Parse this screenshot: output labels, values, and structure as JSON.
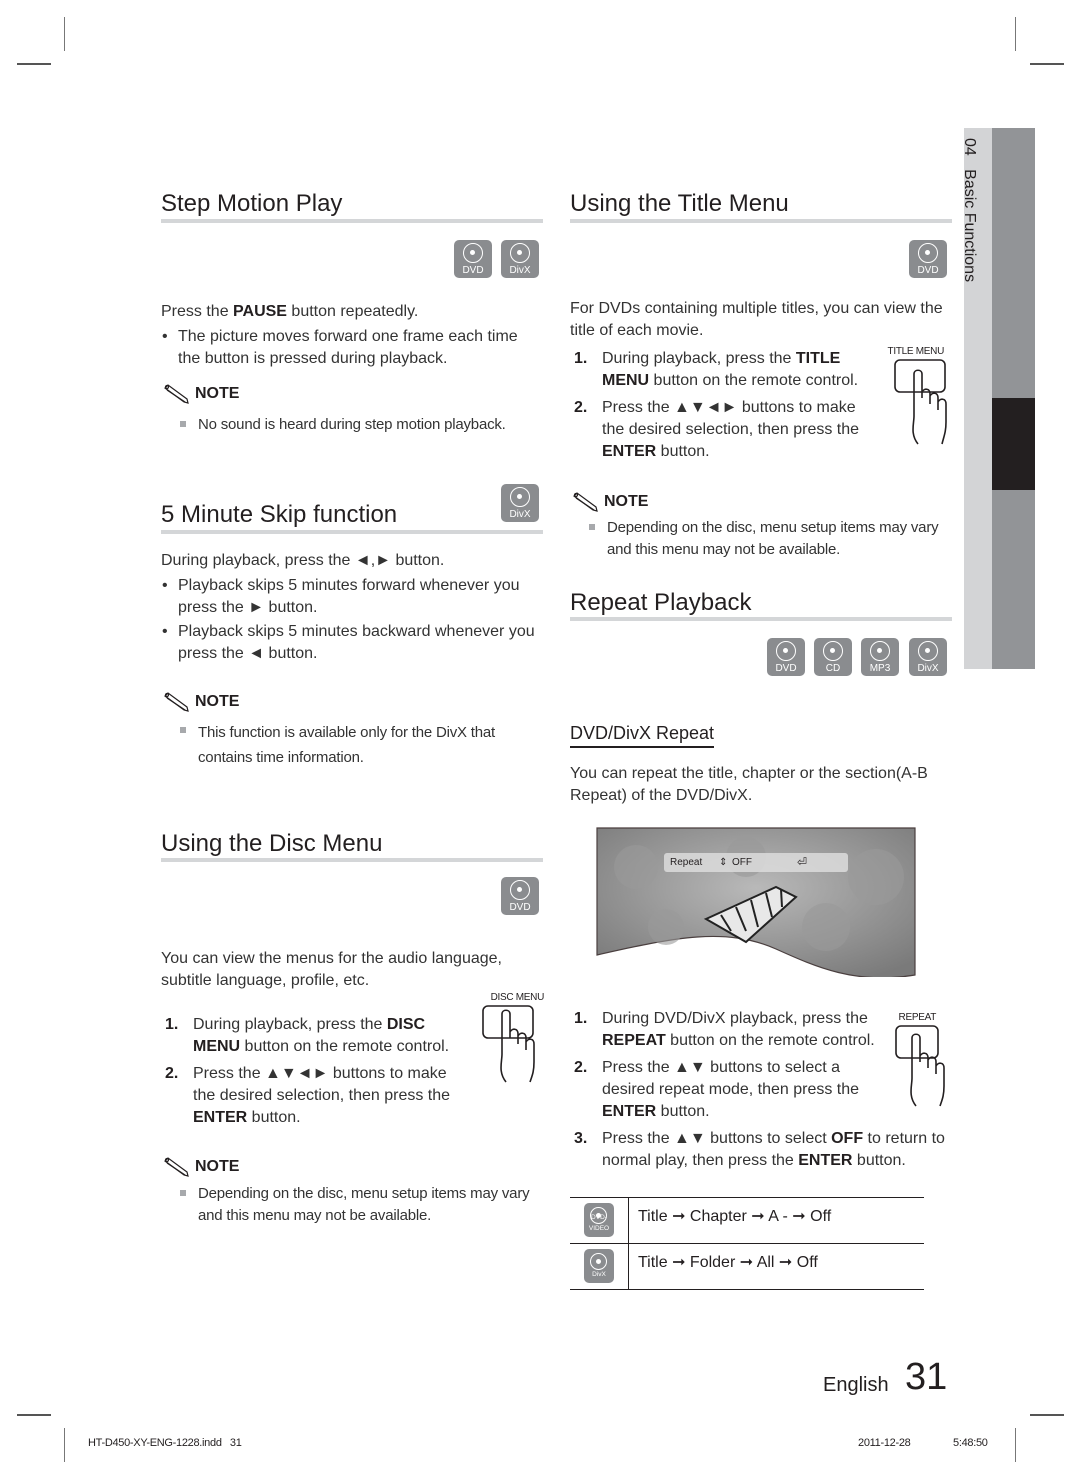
{
  "side_tab": {
    "chapter_number": "04",
    "chapter_title": "Basic Functions"
  },
  "step_motion": {
    "title": "Step Motion Play",
    "disc_icons": [
      "DVD",
      "DivX"
    ],
    "intro_prefix": "Press the ",
    "intro_bold": "PAUSE",
    "intro_suffix": " button repeatedly.",
    "bullets": [
      "The picture moves forward one frame each time the button is pressed during playback."
    ],
    "note_label": "NOTE",
    "notes": [
      "No sound is heard during step motion playback."
    ]
  },
  "minute_skip": {
    "title": "5 Minute Skip function",
    "disc_icons": [
      "DivX"
    ],
    "intro": "During playback, press the ◄,► button.",
    "bullets": [
      "Playback skips 5 minutes forward whenever you press the ► button.",
      "Playback skips 5 minutes backward whenever you press the ◄ button."
    ],
    "note_label": "NOTE",
    "notes": [
      "This function is available only for the DivX that contains time information."
    ]
  },
  "disc_menu": {
    "title": "Using the Disc Menu",
    "disc_icons": [
      "DVD"
    ],
    "intro": "You can view the menus for the audio language, subtitle language, profile, etc.",
    "remote_label": "DISC MENU",
    "steps": [
      {
        "num": "1.",
        "pre": "During playback, press the ",
        "bold": "DISC MENU",
        "post": " button on the remote control."
      },
      {
        "num": "2.",
        "pre": "Press the ▲▼◄► buttons to make the desired selection, then press the ",
        "bold": "ENTER",
        "post": " button."
      }
    ],
    "note_label": "NOTE",
    "notes": [
      "Depending on the disc, menu setup items may vary and this menu may not be available."
    ]
  },
  "title_menu": {
    "title": "Using the Title Menu",
    "disc_icons": [
      "DVD"
    ],
    "intro": "For DVDs containing multiple titles, you can view the title of each movie.",
    "remote_label": "TITLE MENU",
    "steps": [
      {
        "num": "1.",
        "pre": "During playback, press the ",
        "bold": "TITLE MENU",
        "post": " button on the remote control."
      },
      {
        "num": "2.",
        "pre": "Press the ▲▼◄► buttons to make the desired selection, then press the ",
        "bold": "ENTER",
        "post": " button."
      }
    ],
    "note_label": "NOTE",
    "notes": [
      "Depending on the disc, menu setup items may vary and this menu may not be available."
    ]
  },
  "repeat": {
    "title": "Repeat Playback",
    "disc_icons": [
      "DVD",
      "CD",
      "MP3",
      "DivX"
    ],
    "subheading": "DVD/DivX Repeat",
    "intro": "You can repeat the title, chapter or the section(A-B Repeat) of the DVD/DivX.",
    "osd": {
      "label": "Repeat",
      "value": "OFF"
    },
    "remote_label": "REPEAT",
    "steps": [
      {
        "num": "1.",
        "pre": "During DVD/DivX playback, press the ",
        "bold": "REPEAT",
        "post": " button on the remote control."
      },
      {
        "num": "2.",
        "pre": "Press the ▲▼ buttons to select a desired repeat mode, then press the ",
        "bold": "ENTER",
        "post": " button."
      },
      {
        "num": "3.",
        "pre": "Press the ▲▼ buttons to select ",
        "bold": "OFF",
        "post": " to return to normal play, then press the ",
        "bold2": "ENTER",
        "post2": " button."
      }
    ],
    "table": [
      {
        "icon": "DVD-VIDEO",
        "sequence": "Title ➞ Chapter ➞ A - ➞ Off"
      },
      {
        "icon": "DivX",
        "sequence": "Title ➞ Folder ➞ All ➞ Off"
      }
    ]
  },
  "footer": {
    "language": "English",
    "page_number": "31",
    "print_file": "HT-D450-XY-ENG-1228.indd   31",
    "print_date": "2011-12-28",
    "print_time": "5:48:50"
  }
}
